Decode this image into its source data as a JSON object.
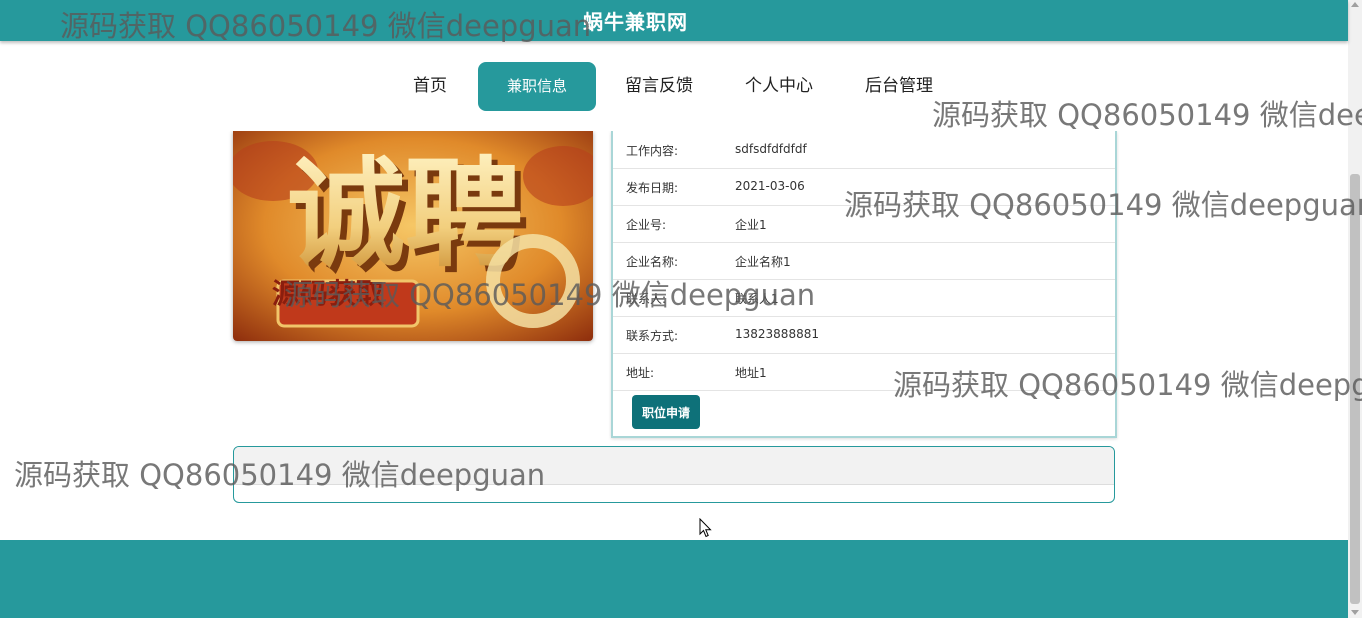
{
  "header": {
    "site_title": "蜗牛兼职网"
  },
  "nav": {
    "items": [
      {
        "label": "首页",
        "active": false
      },
      {
        "label": "兼职信息",
        "active": true
      },
      {
        "label": "留言反馈",
        "active": false
      },
      {
        "label": "个人中心",
        "active": false
      },
      {
        "label": "后台管理",
        "active": false
      }
    ]
  },
  "poster": {
    "text": "诚聘",
    "overlay_text": "源码获取"
  },
  "job_details": {
    "rows": [
      {
        "label": "工作内容:",
        "value": "sdfsdfdfdfdf"
      },
      {
        "label": "发布日期:",
        "value": "2021-03-06"
      },
      {
        "label": "企业号:",
        "value": "企业1"
      },
      {
        "label": "企业名称:",
        "value": "企业名称1"
      },
      {
        "label": "联系人:",
        "value": "联系人1"
      },
      {
        "label": "联系方式:",
        "value": "13823888881"
      },
      {
        "label": "地址:",
        "value": "地址1"
      }
    ],
    "apply_button": "职位申请"
  },
  "watermark": {
    "text": "源码获取 QQ86050149 微信deepguan"
  },
  "colors": {
    "brand": "#26999c",
    "button_dark": "#0e7179"
  }
}
